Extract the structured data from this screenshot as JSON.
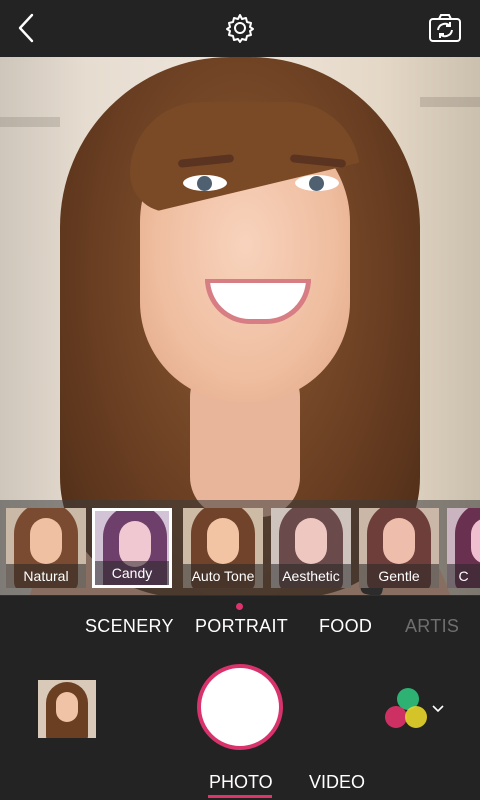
{
  "top_bar": {
    "back_icon": "chevron-left-icon",
    "settings_icon": "gear-icon",
    "camera_flip_icon": "camera-flip-icon"
  },
  "filters": [
    {
      "label": "Natural",
      "selected": false,
      "tint": "#7a4b30"
    },
    {
      "label": "Candy",
      "selected": true,
      "tint": "#6d3f6a"
    },
    {
      "label": "Auto Tone",
      "selected": false,
      "tint": "#70432a"
    },
    {
      "label": "Aesthetic",
      "selected": false,
      "tint": "#6a4a4a"
    },
    {
      "label": "Gentle",
      "selected": false,
      "tint": "#6e3f3a"
    },
    {
      "label": "C",
      "selected": false,
      "tint": "#6a3050"
    }
  ],
  "modes": [
    {
      "label": "SCENERY",
      "active": false
    },
    {
      "label": "PORTRAIT",
      "active": true
    },
    {
      "label": "FOOD",
      "active": false
    },
    {
      "label": "ARTIS",
      "active": false
    }
  ],
  "bottom_tabs": [
    {
      "label": "PHOTO",
      "active": true
    },
    {
      "label": "VIDEO",
      "active": false
    }
  ],
  "colors": {
    "accent": "#e0336b",
    "background": "#232323"
  },
  "icons": {
    "color_filter": "color-filter-icon",
    "dropdown": "chevron-down-icon"
  }
}
